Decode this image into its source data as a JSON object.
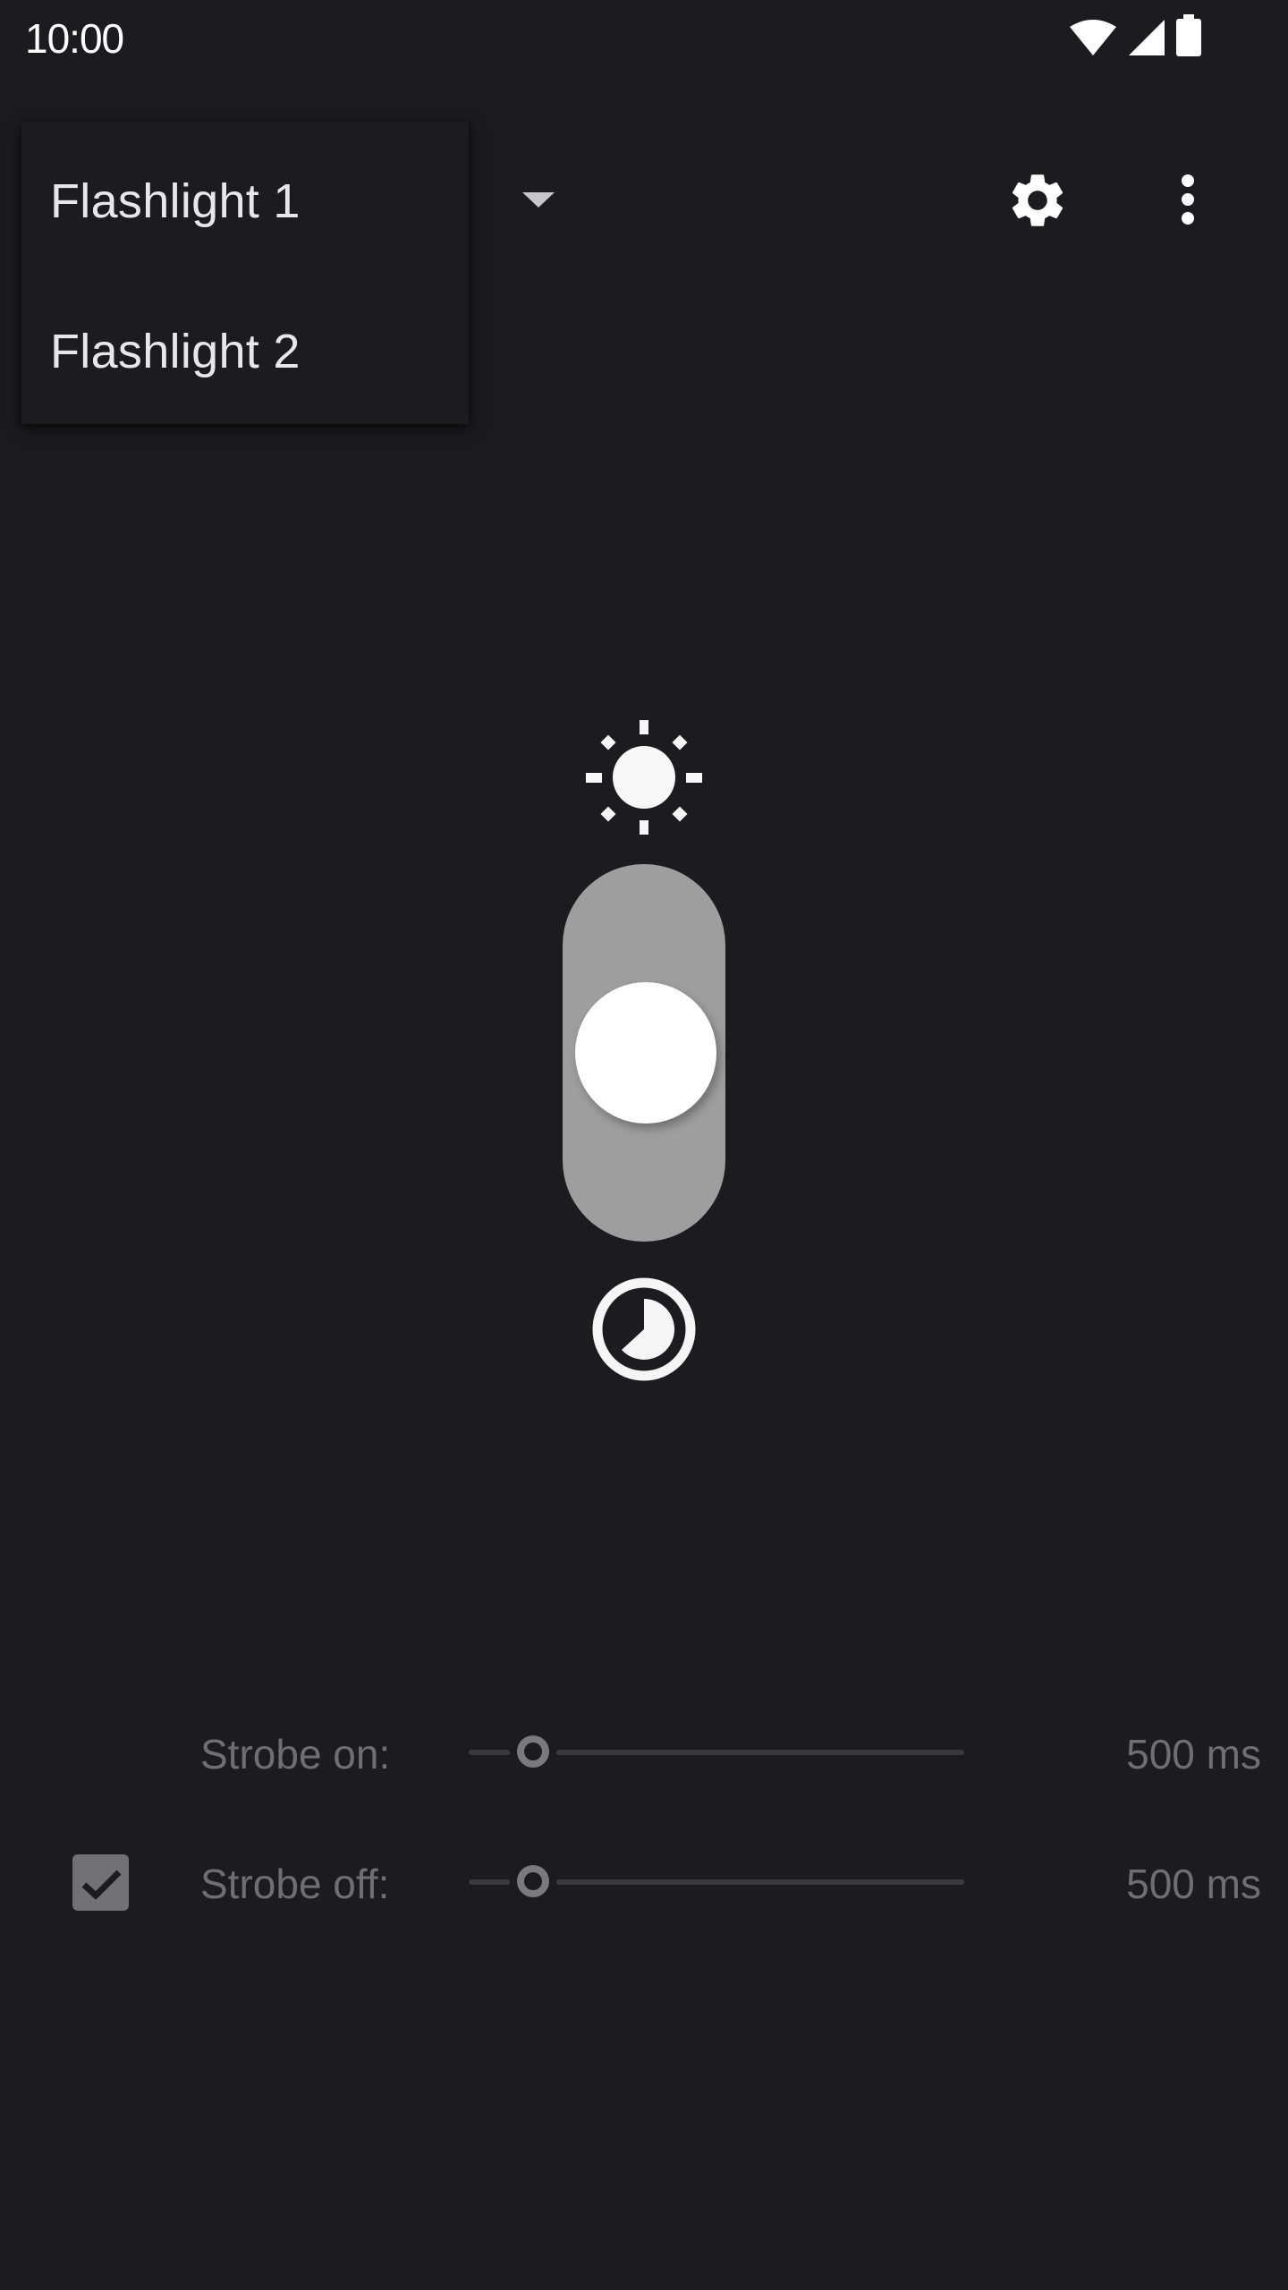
{
  "status_bar": {
    "time": "10:00",
    "icons": [
      "wifi-icon",
      "cellular-signal-icon",
      "battery-icon"
    ]
  },
  "toolbar": {
    "flashlight_dropdown": {
      "selected": "Flashlight 1",
      "options": [
        "Flashlight 1",
        "Flashlight 2"
      ],
      "expanded": true
    },
    "settings_icon": "gear-icon",
    "more_icon": "more-vert-icon"
  },
  "controls": {
    "brightness_icon": "sun-icon",
    "power_switch": {
      "state": "middle",
      "position_fraction": 0.5
    },
    "timer_icon": "timer-icon"
  },
  "strobe": {
    "enabled": true,
    "on": {
      "label": "Strobe on:",
      "value": "500 ms",
      "slider_fraction": 0.13
    },
    "off": {
      "label": "Strobe off:",
      "value": "500 ms",
      "slider_fraction": 0.13
    }
  },
  "colors": {
    "background": "#1c1b20",
    "switch_track": "#9e9e9e",
    "muted_text": "#6f6e73"
  }
}
